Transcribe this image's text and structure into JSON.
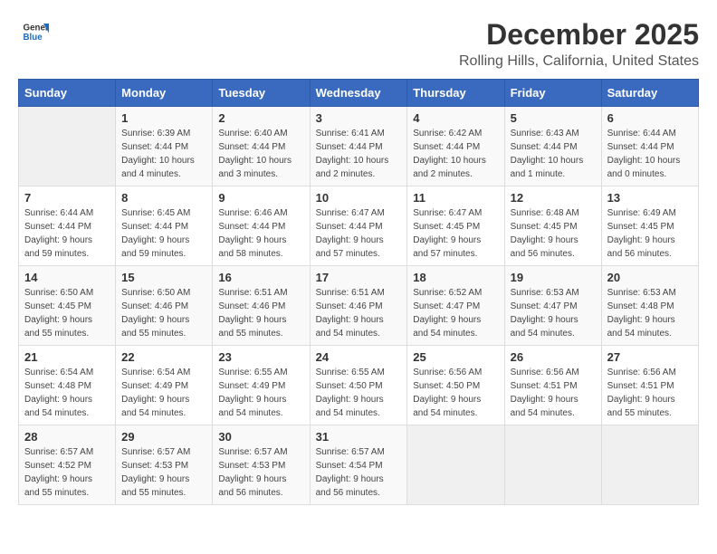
{
  "header": {
    "logo_general": "General",
    "logo_blue": "Blue",
    "month": "December 2025",
    "location": "Rolling Hills, California, United States"
  },
  "weekdays": [
    "Sunday",
    "Monday",
    "Tuesday",
    "Wednesday",
    "Thursday",
    "Friday",
    "Saturday"
  ],
  "weeks": [
    [
      {
        "day": "",
        "info": ""
      },
      {
        "day": "1",
        "info": "Sunrise: 6:39 AM\nSunset: 4:44 PM\nDaylight: 10 hours\nand 4 minutes."
      },
      {
        "day": "2",
        "info": "Sunrise: 6:40 AM\nSunset: 4:44 PM\nDaylight: 10 hours\nand 3 minutes."
      },
      {
        "day": "3",
        "info": "Sunrise: 6:41 AM\nSunset: 4:44 PM\nDaylight: 10 hours\nand 2 minutes."
      },
      {
        "day": "4",
        "info": "Sunrise: 6:42 AM\nSunset: 4:44 PM\nDaylight: 10 hours\nand 2 minutes."
      },
      {
        "day": "5",
        "info": "Sunrise: 6:43 AM\nSunset: 4:44 PM\nDaylight: 10 hours\nand 1 minute."
      },
      {
        "day": "6",
        "info": "Sunrise: 6:44 AM\nSunset: 4:44 PM\nDaylight: 10 hours\nand 0 minutes."
      }
    ],
    [
      {
        "day": "7",
        "info": "Sunrise: 6:44 AM\nSunset: 4:44 PM\nDaylight: 9 hours\nand 59 minutes."
      },
      {
        "day": "8",
        "info": "Sunrise: 6:45 AM\nSunset: 4:44 PM\nDaylight: 9 hours\nand 59 minutes."
      },
      {
        "day": "9",
        "info": "Sunrise: 6:46 AM\nSunset: 4:44 PM\nDaylight: 9 hours\nand 58 minutes."
      },
      {
        "day": "10",
        "info": "Sunrise: 6:47 AM\nSunset: 4:44 PM\nDaylight: 9 hours\nand 57 minutes."
      },
      {
        "day": "11",
        "info": "Sunrise: 6:47 AM\nSunset: 4:45 PM\nDaylight: 9 hours\nand 57 minutes."
      },
      {
        "day": "12",
        "info": "Sunrise: 6:48 AM\nSunset: 4:45 PM\nDaylight: 9 hours\nand 56 minutes."
      },
      {
        "day": "13",
        "info": "Sunrise: 6:49 AM\nSunset: 4:45 PM\nDaylight: 9 hours\nand 56 minutes."
      }
    ],
    [
      {
        "day": "14",
        "info": "Sunrise: 6:50 AM\nSunset: 4:45 PM\nDaylight: 9 hours\nand 55 minutes."
      },
      {
        "day": "15",
        "info": "Sunrise: 6:50 AM\nSunset: 4:46 PM\nDaylight: 9 hours\nand 55 minutes."
      },
      {
        "day": "16",
        "info": "Sunrise: 6:51 AM\nSunset: 4:46 PM\nDaylight: 9 hours\nand 55 minutes."
      },
      {
        "day": "17",
        "info": "Sunrise: 6:51 AM\nSunset: 4:46 PM\nDaylight: 9 hours\nand 54 minutes."
      },
      {
        "day": "18",
        "info": "Sunrise: 6:52 AM\nSunset: 4:47 PM\nDaylight: 9 hours\nand 54 minutes."
      },
      {
        "day": "19",
        "info": "Sunrise: 6:53 AM\nSunset: 4:47 PM\nDaylight: 9 hours\nand 54 minutes."
      },
      {
        "day": "20",
        "info": "Sunrise: 6:53 AM\nSunset: 4:48 PM\nDaylight: 9 hours\nand 54 minutes."
      }
    ],
    [
      {
        "day": "21",
        "info": "Sunrise: 6:54 AM\nSunset: 4:48 PM\nDaylight: 9 hours\nand 54 minutes."
      },
      {
        "day": "22",
        "info": "Sunrise: 6:54 AM\nSunset: 4:49 PM\nDaylight: 9 hours\nand 54 minutes."
      },
      {
        "day": "23",
        "info": "Sunrise: 6:55 AM\nSunset: 4:49 PM\nDaylight: 9 hours\nand 54 minutes."
      },
      {
        "day": "24",
        "info": "Sunrise: 6:55 AM\nSunset: 4:50 PM\nDaylight: 9 hours\nand 54 minutes."
      },
      {
        "day": "25",
        "info": "Sunrise: 6:56 AM\nSunset: 4:50 PM\nDaylight: 9 hours\nand 54 minutes."
      },
      {
        "day": "26",
        "info": "Sunrise: 6:56 AM\nSunset: 4:51 PM\nDaylight: 9 hours\nand 54 minutes."
      },
      {
        "day": "27",
        "info": "Sunrise: 6:56 AM\nSunset: 4:51 PM\nDaylight: 9 hours\nand 55 minutes."
      }
    ],
    [
      {
        "day": "28",
        "info": "Sunrise: 6:57 AM\nSunset: 4:52 PM\nDaylight: 9 hours\nand 55 minutes."
      },
      {
        "day": "29",
        "info": "Sunrise: 6:57 AM\nSunset: 4:53 PM\nDaylight: 9 hours\nand 55 minutes."
      },
      {
        "day": "30",
        "info": "Sunrise: 6:57 AM\nSunset: 4:53 PM\nDaylight: 9 hours\nand 56 minutes."
      },
      {
        "day": "31",
        "info": "Sunrise: 6:57 AM\nSunset: 4:54 PM\nDaylight: 9 hours\nand 56 minutes."
      },
      {
        "day": "",
        "info": ""
      },
      {
        "day": "",
        "info": ""
      },
      {
        "day": "",
        "info": ""
      }
    ]
  ]
}
